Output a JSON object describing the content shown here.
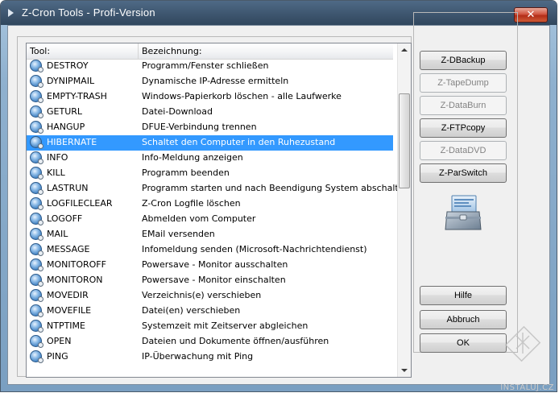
{
  "window": {
    "title": "Z-Cron Tools - Profi-Version",
    "close_glyph": "✕"
  },
  "list": {
    "columns": {
      "tool": "Tool:",
      "description": "Bezeichnung:"
    },
    "rows": [
      {
        "tool": "DESTROY",
        "desc": "Programm/Fenster schließen"
      },
      {
        "tool": "DYNIPMAIL",
        "desc": "Dynamische IP-Adresse ermitteln"
      },
      {
        "tool": "EMPTY-TRASH",
        "desc": "Windows-Papierkorb löschen - alle Laufwerke"
      },
      {
        "tool": "GETURL",
        "desc": "Datei-Download"
      },
      {
        "tool": "HANGUP",
        "desc": "DFUE-Verbindung trennen"
      },
      {
        "tool": "HIBERNATE",
        "desc": "Schaltet den Computer in den Ruhezustand",
        "selected": true
      },
      {
        "tool": "INFO",
        "desc": "Info-Meldung anzeigen"
      },
      {
        "tool": "KILL",
        "desc": "Programm beenden"
      },
      {
        "tool": "LASTRUN",
        "desc": "Programm starten und nach Beendigung System abschalten."
      },
      {
        "tool": "LOGFILECLEAR",
        "desc": "Z-Cron Logfile löschen"
      },
      {
        "tool": "LOGOFF",
        "desc": "Abmelden vom Computer"
      },
      {
        "tool": "MAIL",
        "desc": "EMail versenden"
      },
      {
        "tool": "MESSAGE",
        "desc": "Infomeldung senden (Microsoft-Nachrichtendienst)"
      },
      {
        "tool": "MONITOROFF",
        "desc": "Powersave - Monitor ausschalten"
      },
      {
        "tool": "MONITORON",
        "desc": "Powersave - Monitor einschalten"
      },
      {
        "tool": "MOVEDIR",
        "desc": "Verzeichnis(e) verschieben"
      },
      {
        "tool": "MOVEFILE",
        "desc": "Datei(en) verschieben"
      },
      {
        "tool": "NTPTIME",
        "desc": "Systemzeit mit Zeitserver abgleichen"
      },
      {
        "tool": "OPEN",
        "desc": "Dateien und Dokumente öffnen/ausführen"
      },
      {
        "tool": "PING",
        "desc": "IP-Überwachung mit Ping"
      }
    ],
    "row_icon": "tool-globe-icon"
  },
  "buttons": {
    "zdbackup": "Z-DBackup",
    "ztapedump": "Z-TapeDump",
    "zdataburn": "Z-DataBurn",
    "zftpcopy": "Z-FTPcopy",
    "zdatadvd": "Z-DataDVD",
    "zparswitch": "Z-ParSwitch",
    "hilfe": "Hilfe",
    "abbruch": "Abbruch",
    "ok": "OK"
  },
  "watermark": {
    "text": "INSTALUJ.CZ"
  },
  "colors": {
    "selection": "#3399ff",
    "close_button": "#c8432a",
    "title_bar": "#30465d"
  }
}
